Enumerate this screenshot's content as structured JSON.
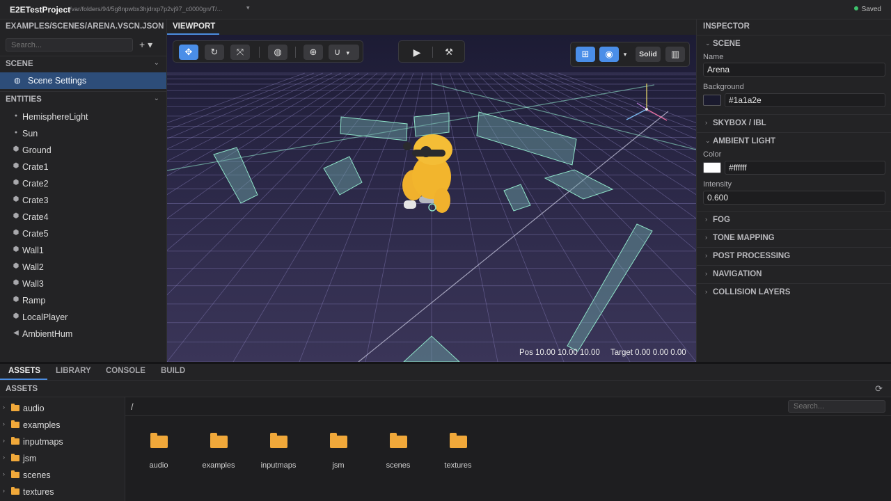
{
  "titlebar": {
    "project": "E2ETestProject",
    "path": "/var/folders/94/5g8npwbx3hjdrxp7p2vj97_c0000gn/T/...",
    "status": "Saved"
  },
  "left": {
    "file": "EXAMPLES/SCENES/ARENA.VSCN.JSON",
    "search_placeholder": "Search...",
    "add_label": "+ ▾",
    "scene_header": "SCENE",
    "scene_item": "Scene Settings",
    "entities_header": "ENTITIES",
    "entities": [
      {
        "label": "HemisphereLight",
        "icon": "bulb-icon"
      },
      {
        "label": "Sun",
        "icon": "bulb-icon"
      },
      {
        "label": "Ground",
        "icon": "cube-icon"
      },
      {
        "label": "Crate1",
        "icon": "cube-icon"
      },
      {
        "label": "Crate2",
        "icon": "cube-icon"
      },
      {
        "label": "Crate3",
        "icon": "cube-icon"
      },
      {
        "label": "Crate4",
        "icon": "cube-icon"
      },
      {
        "label": "Crate5",
        "icon": "cube-icon"
      },
      {
        "label": "Wall1",
        "icon": "cube-icon"
      },
      {
        "label": "Wall2",
        "icon": "cube-icon"
      },
      {
        "label": "Wall3",
        "icon": "cube-icon"
      },
      {
        "label": "Ramp",
        "icon": "cube-icon"
      },
      {
        "label": "LocalPlayer",
        "icon": "cube-icon"
      },
      {
        "label": "AmbientHum",
        "icon": "speaker-icon"
      }
    ]
  },
  "viewport": {
    "tab": "VIEWPORT",
    "shading_label": "Solid",
    "pos_label": "Pos 10.00 10.00 10.00",
    "target_label": "Target 0.00 0.00 0.00"
  },
  "inspector": {
    "title": "INSPECTOR",
    "scene_section": "SCENE",
    "name_label": "Name",
    "name_value": "Arena",
    "background_label": "Background",
    "background_value": "#1a1a2e",
    "skybox_section": "SKYBOX / IBL",
    "ambient_section": "AMBIENT LIGHT",
    "color_label": "Color",
    "color_value": "#ffffff",
    "intensity_label": "Intensity",
    "intensity_value": "0.600",
    "sections": [
      "FOG",
      "TONE MAPPING",
      "POST PROCESSING",
      "NAVIGATION",
      "COLLISION LAYERS"
    ]
  },
  "bottom": {
    "tabs": [
      "ASSETS",
      "LIBRARY",
      "CONSOLE",
      "BUILD"
    ],
    "assets_header": "ASSETS",
    "breadcrumb": "/",
    "search_placeholder": "Search...",
    "folders": [
      "audio",
      "examples",
      "inputmaps",
      "jsm",
      "scenes",
      "textures"
    ]
  },
  "colors": {
    "accent": "#4c8de0",
    "selection": "#2d4d79",
    "folder": "#f0a83a",
    "saved_dot": "#3ec46d",
    "wireframe": "#8fe3c9"
  }
}
